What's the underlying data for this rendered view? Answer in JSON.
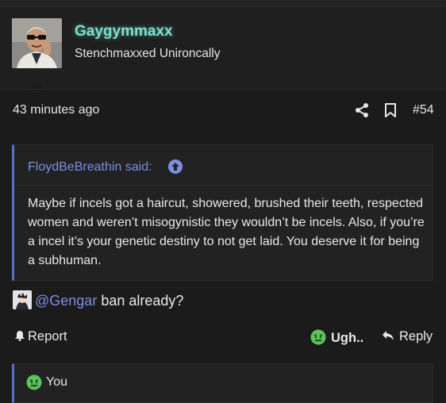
{
  "post": {
    "username": "Gaygymmaxx",
    "user_title": "Stenchmaxxed Unironcally",
    "timestamp": "43 minutes ago",
    "post_number": "#54",
    "quote": {
      "author_label": "FloydBeBreathin said:",
      "body": "Maybe if incels got a haircut, showered, brushed their teeth, respected women and weren’t misogynistic they wouldn’t be incels. Also, if you’re a incel it’s your genetic destiny to not get laid. You deserve it for being a subhuman."
    },
    "message": {
      "mention": "@Gengar",
      "text": " ban already?"
    },
    "actions": {
      "report": "Report",
      "reaction": "Ugh..",
      "reply": "Reply"
    },
    "reactions_summary": "You"
  },
  "colors": {
    "username_glow": "#7ae0d0",
    "link": "#7b8fe0",
    "quote_border": "#5b6ec4",
    "reaction_green": "#5cc45a"
  },
  "icons": [
    "share-icon",
    "bookmark-icon",
    "up-arrow-icon",
    "bell-icon",
    "sick-face-icon",
    "reply-icon"
  ]
}
